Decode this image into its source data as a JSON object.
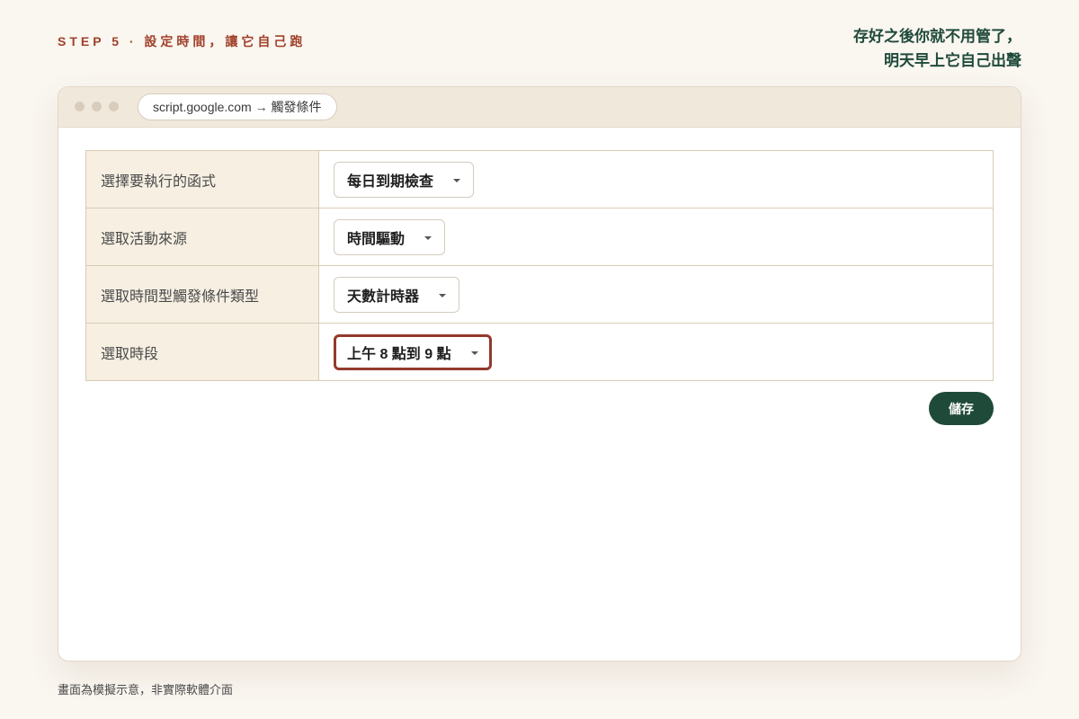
{
  "header": {
    "step_label": "STEP 5 · 設定時間，讓它自己跑",
    "tagline_line1": "存好之後你就不用管了，",
    "tagline_line2": "明天早上它自己出聲"
  },
  "browser": {
    "url": "script.google.com → 觸發條件"
  },
  "form": {
    "rows": [
      {
        "label": "選擇要執行的函式",
        "value": "每日到期檢查",
        "icon": "chevron-down-icon"
      },
      {
        "label": "選取活動來源",
        "value": "時間驅動",
        "icon": "chevron-down-icon"
      },
      {
        "label": "選取時間型觸發條件類型",
        "value": "天數計時器",
        "icon": "chevron-down-icon"
      },
      {
        "label": "選取時段",
        "value": "上午 8 點到 9 點",
        "icon": "chevron-down-icon",
        "highlighted": true
      }
    ],
    "save_label": "儲存"
  },
  "footnote": "畫面為模擬示意，非實際軟體介面",
  "colors": {
    "accent_red": "#93392c",
    "brand_green": "#1f4a3a",
    "background": "#faf6f0"
  }
}
